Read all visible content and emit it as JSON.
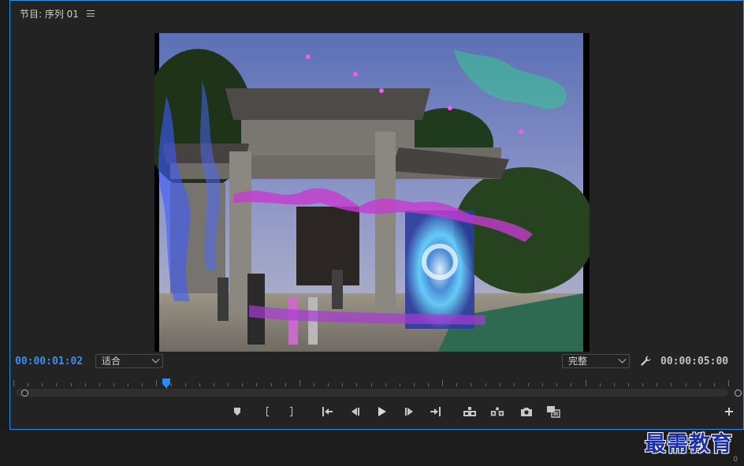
{
  "panel": {
    "title": "节目: 序列 01",
    "menu_icon": "hamburger-menu-icon",
    "border_color": "#2d8ceb"
  },
  "monitor": {
    "current_timecode": "00:00:01:02",
    "duration_timecode": "00:00:05:00",
    "zoom_select": {
      "selected": "适合"
    },
    "quality_select": {
      "selected": "完整"
    },
    "settings_icon": "wrench-icon",
    "playhead_position_fraction": 0.21,
    "timecode_color": "#3d8ee8"
  },
  "transport": {
    "buttons": [
      {
        "name": "add-marker-button",
        "icon": "marker-icon"
      },
      {
        "name": "mark-in-button",
        "icon": "mark-in-icon"
      },
      {
        "name": "mark-out-button",
        "icon": "mark-out-icon"
      },
      {
        "name": "go-to-in-button",
        "icon": "go-to-in-icon"
      },
      {
        "name": "step-back-button",
        "icon": "step-back-icon"
      },
      {
        "name": "play-button",
        "icon": "play-icon"
      },
      {
        "name": "step-forward-button",
        "icon": "step-forward-icon"
      },
      {
        "name": "go-to-out-button",
        "icon": "go-to-out-icon"
      },
      {
        "name": "lift-button",
        "icon": "lift-icon"
      },
      {
        "name": "extract-button",
        "icon": "extract-icon"
      },
      {
        "name": "export-frame-button",
        "icon": "camera-icon"
      },
      {
        "name": "comparison-view-button",
        "icon": "comparison-icon"
      },
      {
        "name": "button-editor-button",
        "icon": "plus-icon"
      }
    ]
  },
  "watermark": {
    "text": "最需教育"
  },
  "meter": {
    "zero_label": "0"
  }
}
